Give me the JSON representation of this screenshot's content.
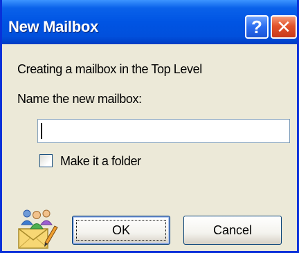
{
  "window": {
    "title": "New Mailbox",
    "help_glyph": "?",
    "close_glyph": "✕"
  },
  "dialog": {
    "location_text": "Creating a mailbox in the Top Level",
    "name_prompt": "Name the new mailbox:",
    "name_value": "",
    "folder_checkbox": {
      "label": "Make it a folder",
      "checked": false
    },
    "ok_label": "OK",
    "cancel_label": "Cancel",
    "icon": "mailbox-users-icon"
  },
  "colors": {
    "titlebar": "#0054e3",
    "dialog_bg": "#ece9d8",
    "close_button": "#e2532b"
  }
}
